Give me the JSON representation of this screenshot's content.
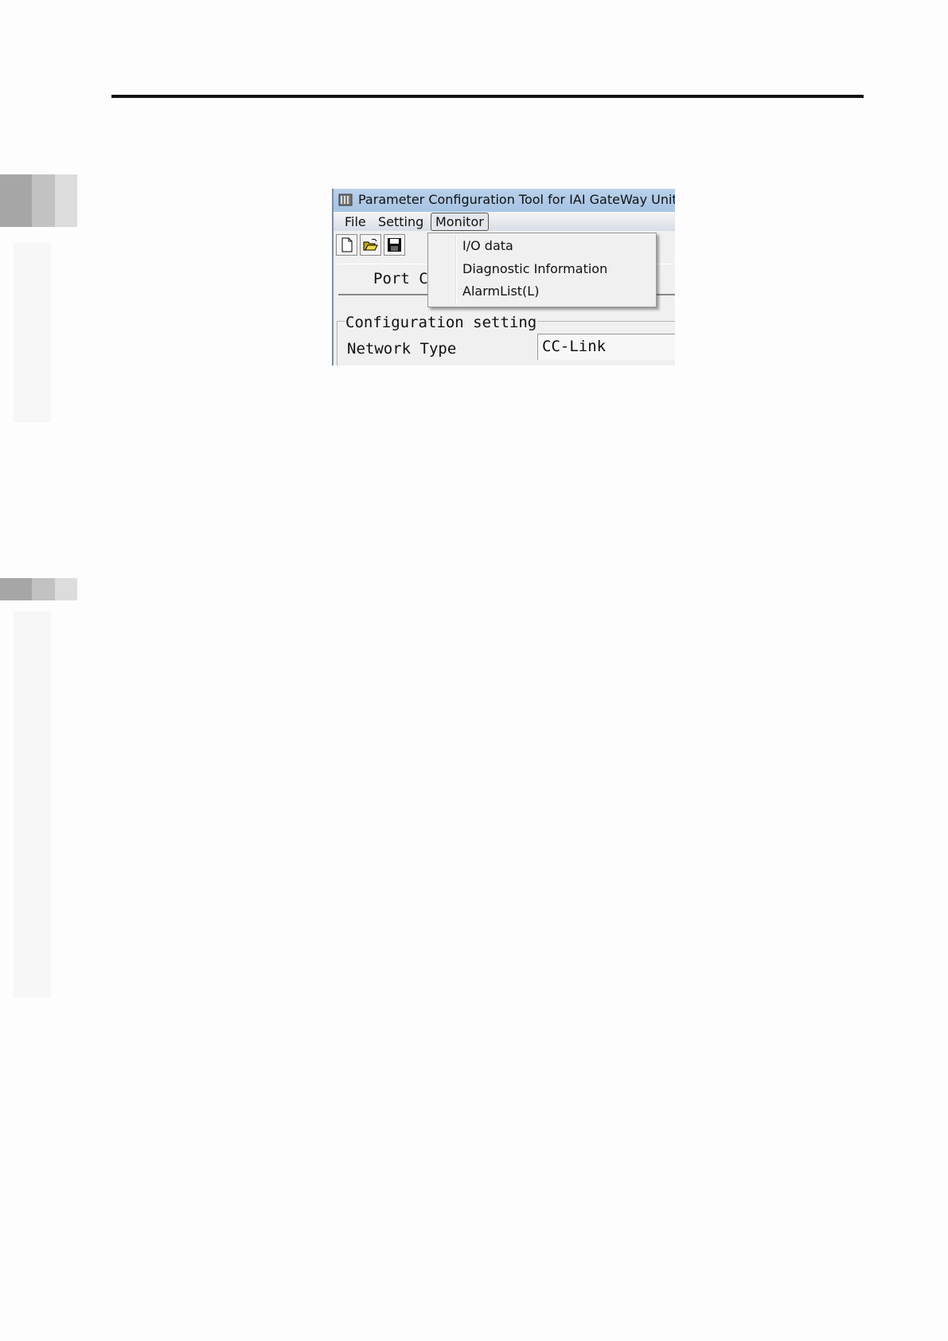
{
  "window": {
    "title": "Parameter Configuration Tool for IAI GateWay Unit"
  },
  "menubar": {
    "file": "File",
    "setting": "Setting",
    "monitor": "Monitor"
  },
  "monitor_menu": {
    "items": [
      "I/O data",
      "Diagnostic Information",
      "AlarmList(L)"
    ]
  },
  "toolbar": {
    "icons": [
      "new-file-icon",
      "open-folder-icon",
      "save-disk-icon"
    ]
  },
  "tabs": {
    "port": "Port C"
  },
  "configuration": {
    "legend": "Configuration setting",
    "network_type_label": "Network Type",
    "network_type_value": "CC-Link"
  },
  "colors": {
    "titlebar": "#b9d1ea",
    "rule": "#111111"
  }
}
